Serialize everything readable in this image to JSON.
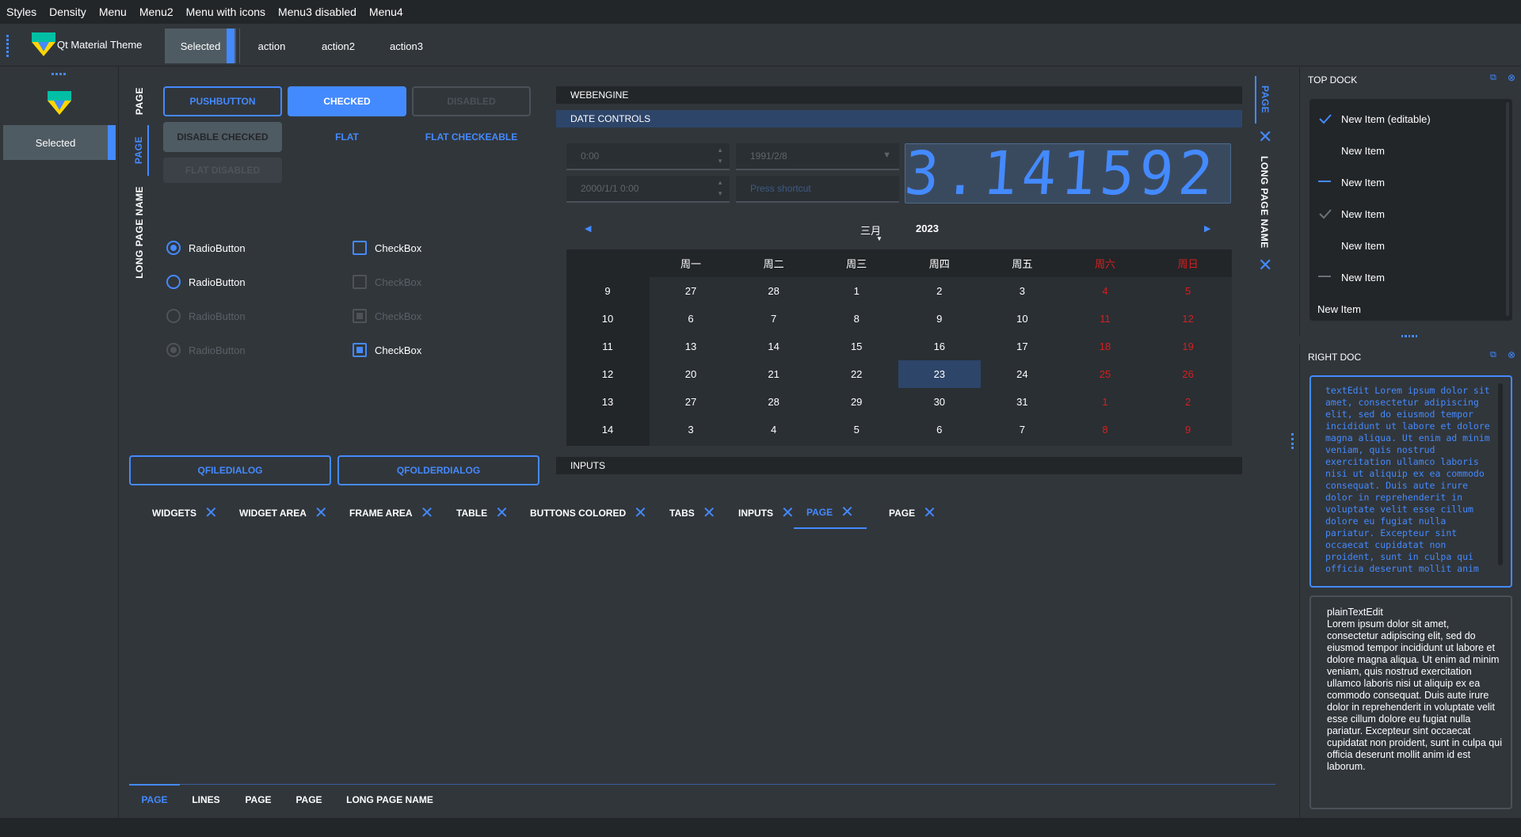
{
  "menubar": [
    "Styles",
    "Density",
    "Menu",
    "Menu2",
    "Menu with icons",
    "Menu3 disabled",
    "Menu4"
  ],
  "toolbar": {
    "app_title": "Qt Material Theme",
    "selected_label": "Selected",
    "actions": [
      "action",
      "action2",
      "action3"
    ]
  },
  "left_dock": {
    "selected_label": "Selected"
  },
  "vertical_tabs_left": [
    "PAGE",
    "PAGE",
    "LONG PAGE NAME"
  ],
  "buttons": {
    "pushbutton": "PUSHBUTTON",
    "checked": "CHECKED",
    "disabled": "DISABLED",
    "disable_checked": "DISABLE CHECKED",
    "flat": "FLAT",
    "flat_checkeable": "FLAT CHECKEABLE",
    "flat_disabled": "FLAT DISABLED"
  },
  "radios": [
    "RadioButton",
    "RadioButton",
    "RadioButton",
    "RadioButton"
  ],
  "checks": [
    "CheckBox",
    "CheckBox",
    "CheckBox",
    "CheckBox"
  ],
  "dialog_buttons": {
    "file": "QFILEDIALOG",
    "folder": "QFOLDERDIALOG"
  },
  "sections": {
    "webengine": "WEBENGINE",
    "date_controls": "DATE CONTROLS",
    "inputs": "INPUTS"
  },
  "date_inputs": {
    "time": "0:00",
    "date": "1991/2/8",
    "datetime": "2000/1/1 0:00",
    "shortcut_placeholder": "Press shortcut"
  },
  "lcd": "3.141592",
  "calendar": {
    "month": "三月",
    "year": "2023",
    "weekdays": [
      "周一",
      "周二",
      "周三",
      "周四",
      "周五",
      "周六",
      "周日"
    ],
    "weeks": [
      "9",
      "10",
      "11",
      "12",
      "13",
      "14"
    ],
    "rows": [
      [
        "27",
        "28",
        "1",
        "2",
        "3",
        "4",
        "5"
      ],
      [
        "6",
        "7",
        "8",
        "9",
        "10",
        "11",
        "12"
      ],
      [
        "13",
        "14",
        "15",
        "16",
        "17",
        "18",
        "19"
      ],
      [
        "20",
        "21",
        "22",
        "23",
        "24",
        "25",
        "26"
      ],
      [
        "27",
        "28",
        "29",
        "30",
        "31",
        "1",
        "2"
      ],
      [
        "3",
        "4",
        "5",
        "6",
        "7",
        "8",
        "9"
      ]
    ],
    "selected": "23",
    "weekend_color": "#d42020"
  },
  "horizontal_tabs": [
    "WIDGETS",
    "WIDGET AREA",
    "FRAME AREA",
    "TABLE",
    "BUTTONS COLORED",
    "TABS",
    "INPUTS",
    "PAGE",
    "PAGE"
  ],
  "active_htab": "PAGE",
  "bottom_tabs": [
    "PAGE",
    "LINES",
    "PAGE",
    "PAGE",
    "LONG PAGE NAME"
  ],
  "vertical_tabs_right": [
    "PAGE",
    "LONG PAGE NAME"
  ],
  "top_dock": {
    "title": "TOP DOCK",
    "items": [
      "New Item (editable)",
      "New Item",
      "New Item",
      "New Item",
      "New Item",
      "New Item",
      "New Item"
    ]
  },
  "right_dock": {
    "title": "RIGHT DOC",
    "text_edit": "textEdit Lorem ipsum dolor sit amet, consectetur adipiscing elit, sed do eiusmod tempor incididunt ut labore et dolore magna aliqua. Ut enim ad minim veniam, quis nostrud exercitation ullamco laboris nisi ut aliquip ex ea commodo consequat. Duis aute irure dolor in reprehenderit in voluptate velit esse cillum dolore eu fugiat nulla pariatur. Excepteur sint occaecat cupidatat non proident, sunt in culpa qui officia deserunt mollit anim",
    "plain_title": "plainTextEdit",
    "plain_text": "Lorem ipsum dolor sit amet, consectetur adipiscing elit, sed do eiusmod tempor incididunt ut labore et dolore magna aliqua. Ut enim ad minim veniam, quis nostrud exercitation ullamco laboris nisi ut aliquip ex ea commodo consequat. Duis aute irure dolor in reprehenderit in voluptate velit esse cillum dolore eu fugiat nulla pariatur. Excepteur sint occaecat cupidatat non proident, sunt in culpa qui officia deserunt mollit anim id est laborum."
  },
  "colors": {
    "accent": "#448aff",
    "bg": "#31363b",
    "dark": "#232629",
    "selected_bg": "#2d4569"
  }
}
